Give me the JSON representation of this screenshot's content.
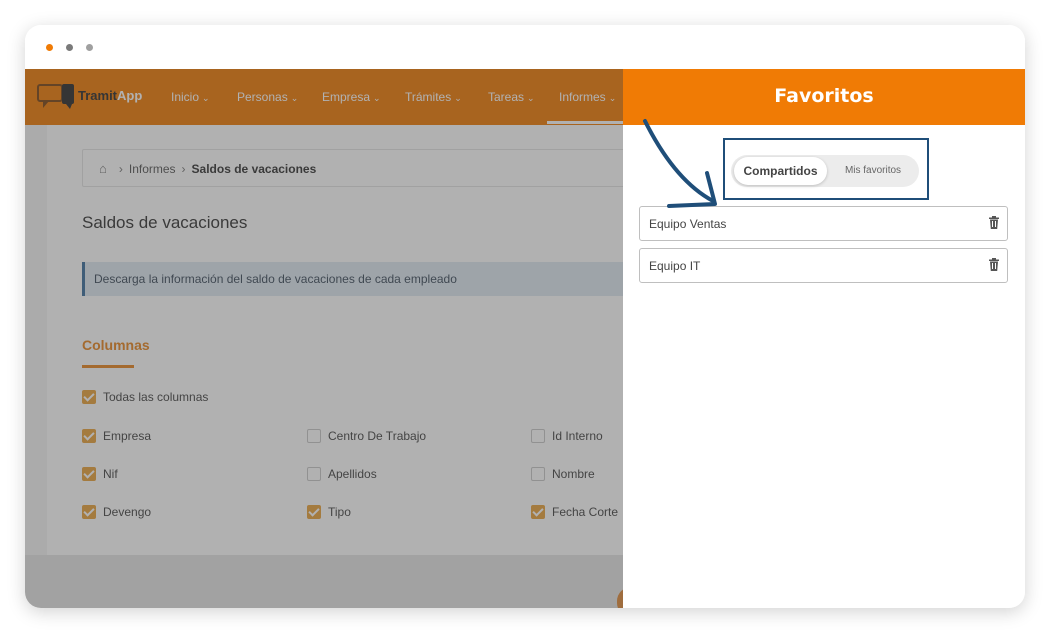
{
  "window": {
    "dots": [
      "orange",
      "gray",
      "lightgray"
    ]
  },
  "app": {
    "logo": {
      "name": "logo-icon",
      "text_bold": "Tramit",
      "text_light": "App"
    },
    "nav": [
      {
        "label": "Inicio"
      },
      {
        "label": "Personas"
      },
      {
        "label": "Empresa"
      },
      {
        "label": "Trámites"
      },
      {
        "label": "Tareas"
      },
      {
        "label": "Informes"
      }
    ],
    "nav_chevron": "⌄",
    "breadcrumb": {
      "home_icon": "home-icon",
      "separator": "›",
      "parent": "Informes",
      "current": "Saldos de vacaciones"
    },
    "page_title": "Saldos de vacaciones",
    "info_text": "Descarga la información del saldo de vacaciones de cada empleado",
    "section_title": "Columnas",
    "all_columns": {
      "label": "Todas las columnas",
      "checked": true
    },
    "columns": [
      {
        "label": "Empresa",
        "checked": true
      },
      {
        "label": "Centro De Trabajo",
        "checked": false
      },
      {
        "label": "Id Interno",
        "checked": false
      },
      {
        "label": "Nif",
        "checked": true
      },
      {
        "label": "Apellidos",
        "checked": false
      },
      {
        "label": "Nombre",
        "checked": false
      },
      {
        "label": "Devengo",
        "checked": true
      },
      {
        "label": "Tipo",
        "checked": true
      },
      {
        "label": "Fecha Corte",
        "checked": true
      }
    ]
  },
  "panel": {
    "title": "Favoritos",
    "tabs": {
      "active": "Compartidos",
      "inactive": "Mis favoritos"
    },
    "items": [
      {
        "label": "Equipo Ventas",
        "icon": "trash-icon"
      },
      {
        "label": "Equipo IT",
        "icon": "trash-icon"
      }
    ]
  },
  "colors": {
    "brand_orange": "#f07b05",
    "accent_navy": "#1f4e79",
    "checkbox_orange": "#e9a23b"
  }
}
